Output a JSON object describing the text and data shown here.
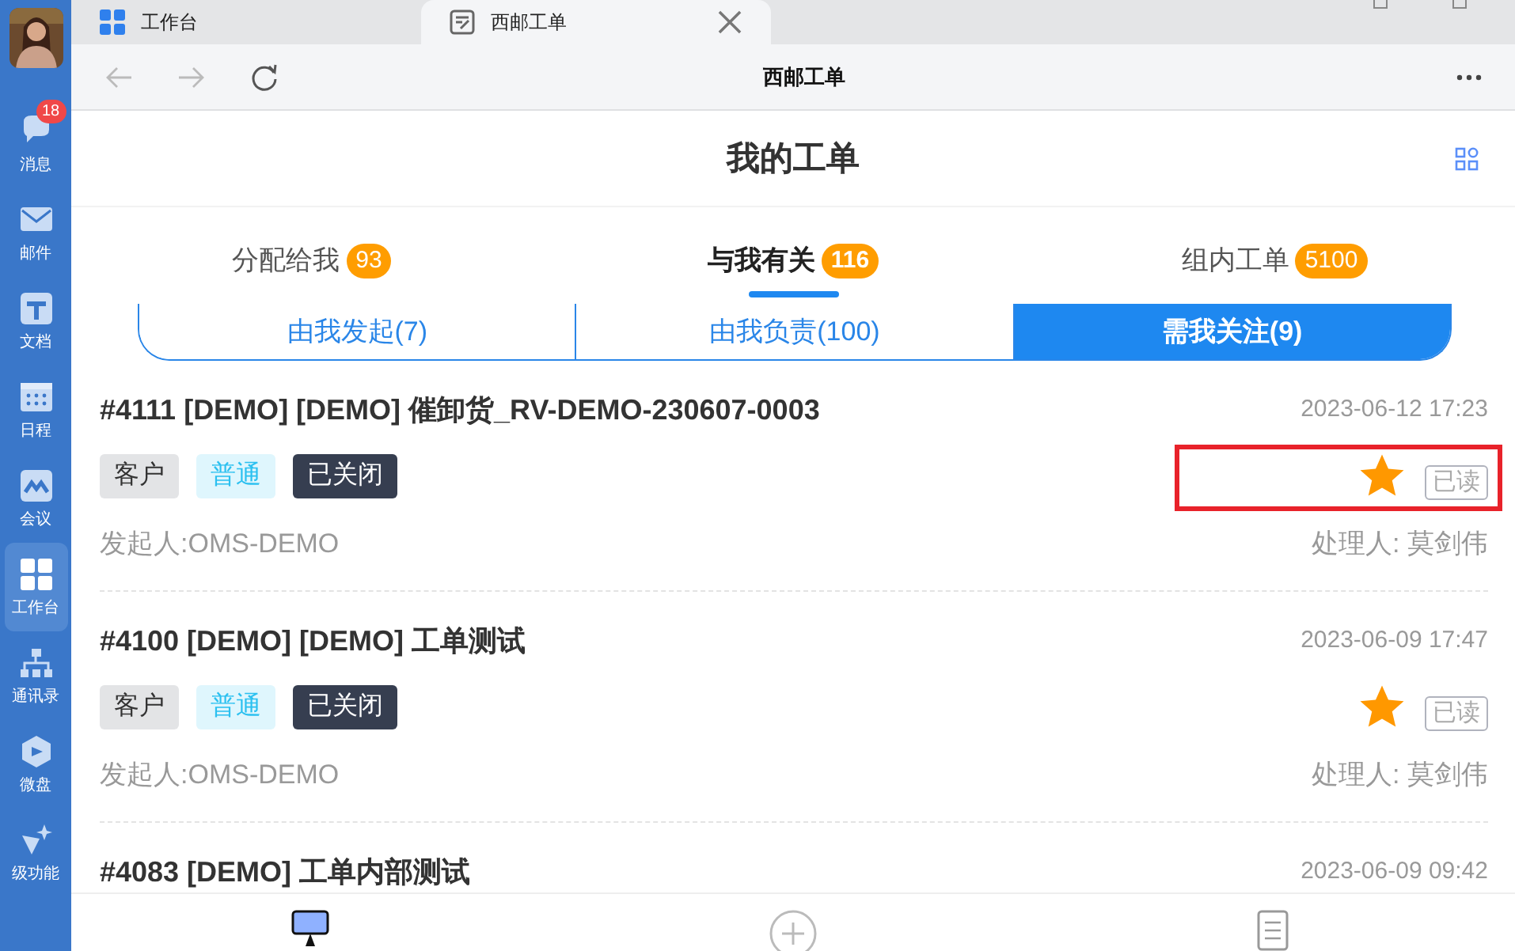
{
  "sidebar": {
    "items": [
      {
        "label": "消息",
        "badge": "18",
        "selected": false
      },
      {
        "label": "邮件",
        "selected": false
      },
      {
        "label": "文档",
        "selected": false
      },
      {
        "label": "日程",
        "selected": false
      },
      {
        "label": "会议",
        "selected": false
      },
      {
        "label": "工作台",
        "selected": true
      },
      {
        "label": "通讯录",
        "selected": false
      },
      {
        "label": "微盘",
        "selected": false
      },
      {
        "label": "级功能",
        "selected": false
      }
    ]
  },
  "browser_tabs": [
    {
      "label": "工作台",
      "selected": false
    },
    {
      "label": "西邮工单",
      "selected": true
    }
  ],
  "nav": {
    "title": "西邮工单",
    "back_disabled": true,
    "forward_disabled": true
  },
  "page": {
    "title": "我的工单"
  },
  "tabs": [
    {
      "label": "分配给我",
      "count": "93",
      "selected": false
    },
    {
      "label": "与我有关",
      "count": "116",
      "selected": true
    },
    {
      "label": "组内工单",
      "count": "5100",
      "selected": false
    }
  ],
  "segments": [
    {
      "label": "由我发起(7)",
      "selected": false
    },
    {
      "label": "由我负责(100)",
      "selected": false
    },
    {
      "label": "需我关注(9)",
      "selected": true
    }
  ],
  "tickets": [
    {
      "title": "#4111 [DEMO] [DEMO] 催卸货_RV-DEMO-230607-0003",
      "time": "2023-06-12 17:23",
      "tags": [
        {
          "text": "客户",
          "kind": "type"
        },
        {
          "text": "普通",
          "kind": "priority"
        },
        {
          "text": "已关闭",
          "kind": "status"
        }
      ],
      "starred": true,
      "read_label": "已读",
      "highlighted": true,
      "initiator": "发起人:OMS-DEMO",
      "handler": "处理人: 莫剑伟"
    },
    {
      "title": "#4100 [DEMO] [DEMO] 工单测试",
      "time": "2023-06-09 17:47",
      "tags": [
        {
          "text": "客户",
          "kind": "type"
        },
        {
          "text": "普通",
          "kind": "priority"
        },
        {
          "text": "已关闭",
          "kind": "status"
        }
      ],
      "starred": true,
      "read_label": "已读",
      "highlighted": false,
      "initiator": "发起人:OMS-DEMO",
      "handler": "处理人: 莫剑伟"
    },
    {
      "title": "#4083 [DEMO] 工单内部测试",
      "time": "2023-06-09 09:42"
    }
  ],
  "bottom_bar": [
    {
      "selected": true
    },
    {
      "selected": false
    },
    {
      "selected": false
    }
  ]
}
